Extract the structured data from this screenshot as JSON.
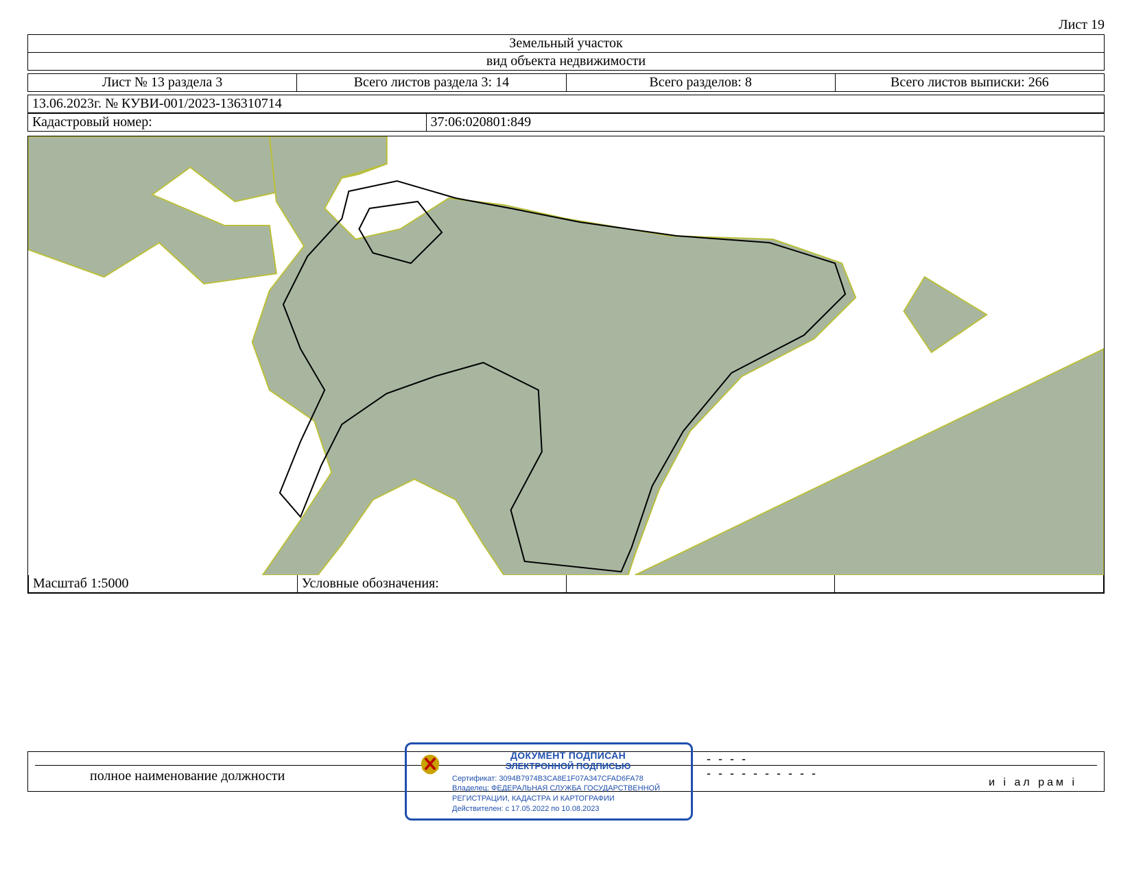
{
  "sheet_label": "Лист 19",
  "header": {
    "title": "Земельный участок",
    "subtitle": "вид объекта недвижимости"
  },
  "meta_row": {
    "col1": "Лист № 13 раздела 3",
    "col2": "Всего листов раздела 3: 14",
    "col3": "Всего разделов: 8",
    "col4": "Всего листов выписки: 266"
  },
  "ref_line": "13.06.2023г. № КУВИ-001/2023-136310714",
  "kadastr": {
    "label": "Кадастровый номер:",
    "value": "37:06:020801:849"
  },
  "map_bottom": {
    "scale": "Масштаб 1:5000",
    "legend": "Условные обозначения:"
  },
  "footer": {
    "position_label": "полное наименование должности"
  },
  "stamp": {
    "line1": "ДОКУМЕНТ ПОДПИСАН",
    "line2": "ЭЛЕКТРОННОЙ ПОДПИСЬЮ",
    "cert": "Сертификат: 3094B7974B3CA8E1F07A347CFAD6FA78",
    "owner": "Владелец: ФЕДЕРАЛЬНАЯ СЛУЖБА ГОСУДАРСТВЕННОЙ РЕГИСТРАЦИИ, КАДАСТРА И КАРТОГРАФИИ",
    "valid": "Действителен: с 17.05.2022 по 10.08.2023"
  },
  "right_glyphs": "и   і   ал   рам   і",
  "colors": {
    "land_fill": "#a8b6a0",
    "land_stroke": "#babf3a",
    "subject_stroke": "#000000",
    "stamp_blue": "#1f4fad"
  }
}
